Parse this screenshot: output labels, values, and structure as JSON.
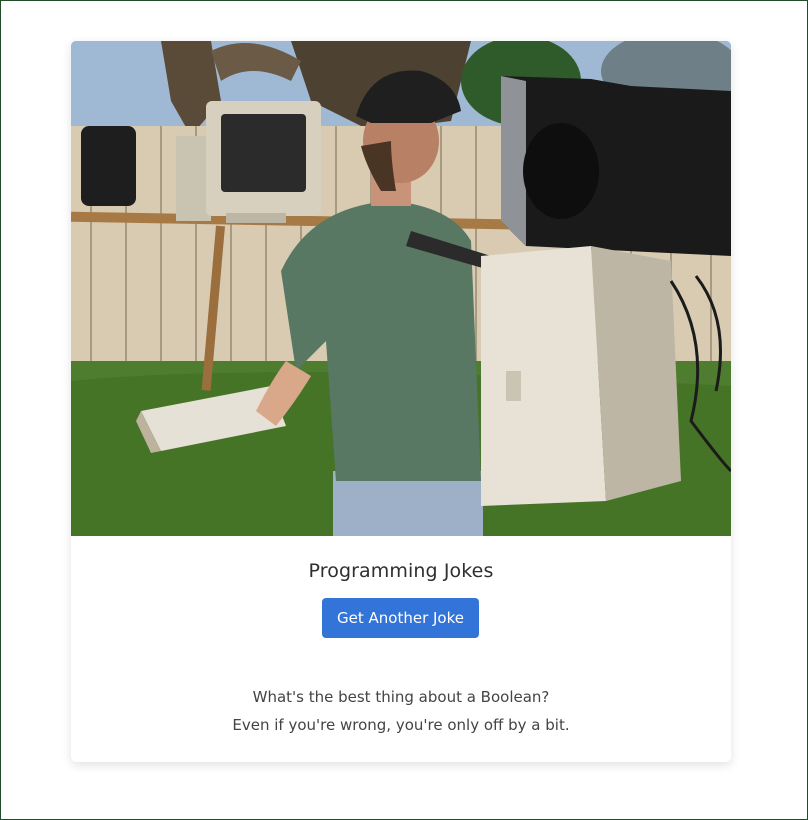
{
  "page": {
    "title": "Programming Jokes",
    "button_label": "Get Another Joke",
    "joke_setup": "What's the best thing about a Boolean?",
    "joke_punchline": "Even if you're wrong, you're only off by a bit."
  },
  "colors": {
    "button": "#3374d9",
    "frame_border": "#1f4d2a",
    "text": "#444444"
  },
  "image": {
    "name": "man-with-wearable-computer-photo"
  }
}
